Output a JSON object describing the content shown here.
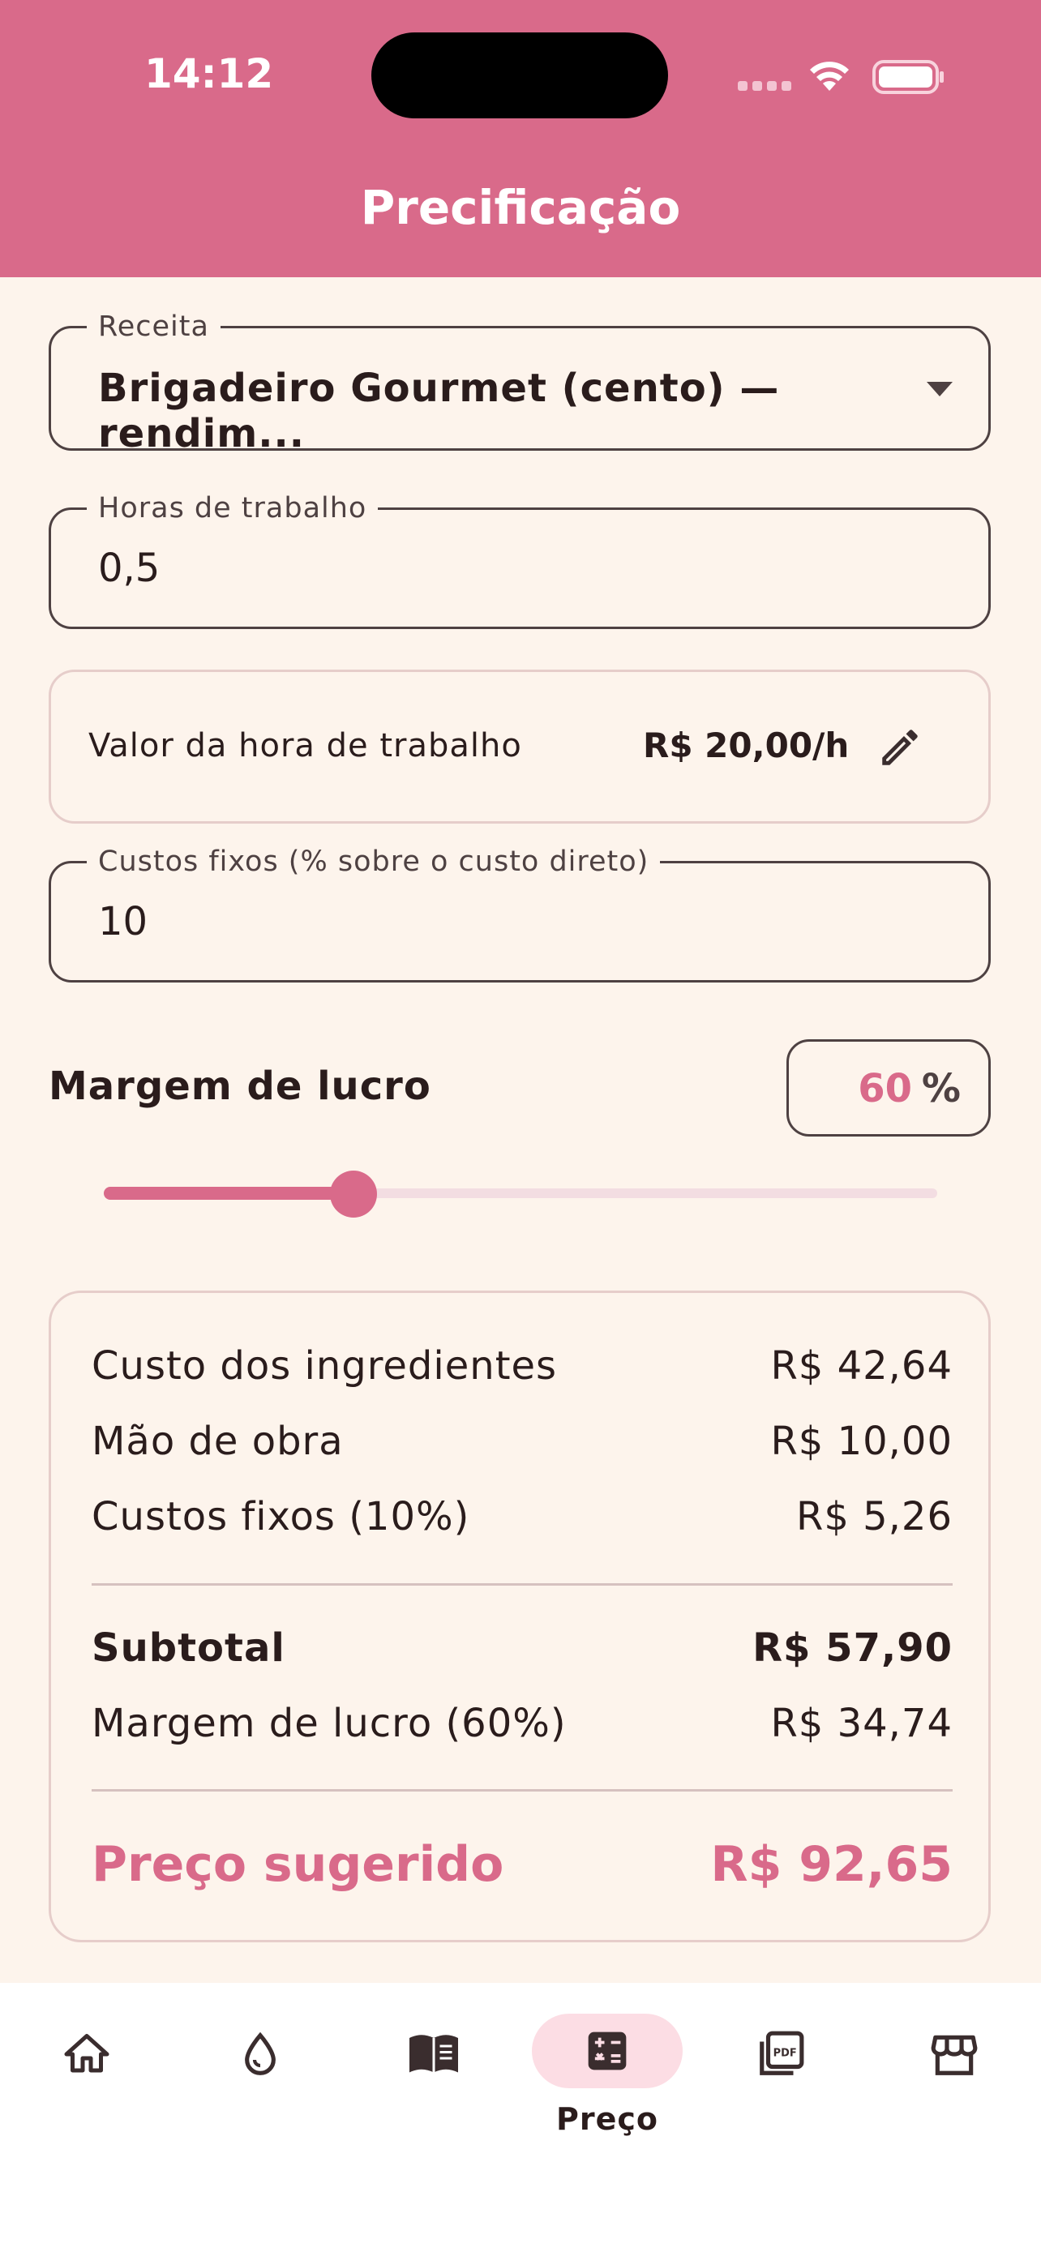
{
  "status_bar": {
    "time": "14:12"
  },
  "header": {
    "title": "Precificação"
  },
  "form": {
    "recipe": {
      "label": "Receita",
      "value": "Brigadeiro Gourmet (cento) — rendim..."
    },
    "hours": {
      "label": "Horas de trabalho",
      "value": "0,5"
    },
    "hour_rate": {
      "label": "Valor da hora de trabalho",
      "value": "R$ 20,00/h"
    },
    "fixed_costs": {
      "label": "Custos fixos (% sobre o custo direto)",
      "value": "10"
    },
    "margin": {
      "label": "Margem de lucro",
      "value": "60",
      "unit": "%",
      "slider_fraction": 0.3
    }
  },
  "summary": {
    "rows": [
      {
        "label": "Custo dos ingredientes",
        "value": "R$ 42,64"
      },
      {
        "label": "Mão de obra",
        "value": "R$ 10,00"
      },
      {
        "label": "Custos fixos (10%)",
        "value": "R$ 5,26"
      }
    ],
    "subtotal": {
      "label": "Subtotal",
      "value": "R$ 57,90"
    },
    "margin_row": {
      "label": "Margem de lucro (60%)",
      "value": "R$ 34,74"
    },
    "suggested": {
      "label": "Preço sugerido",
      "value": "R$ 92,65"
    }
  },
  "bottom_nav": {
    "items": [
      {
        "icon": "home-icon"
      },
      {
        "icon": "drop-icon"
      },
      {
        "icon": "book-icon"
      },
      {
        "icon": "calculator-icon",
        "label": "Preço",
        "active": true
      },
      {
        "icon": "pdf-icon"
      },
      {
        "icon": "store-icon"
      }
    ]
  },
  "colors": {
    "primary": "#d96a8a",
    "background": "#fdf4ec",
    "active_pill": "#fcdde4"
  }
}
